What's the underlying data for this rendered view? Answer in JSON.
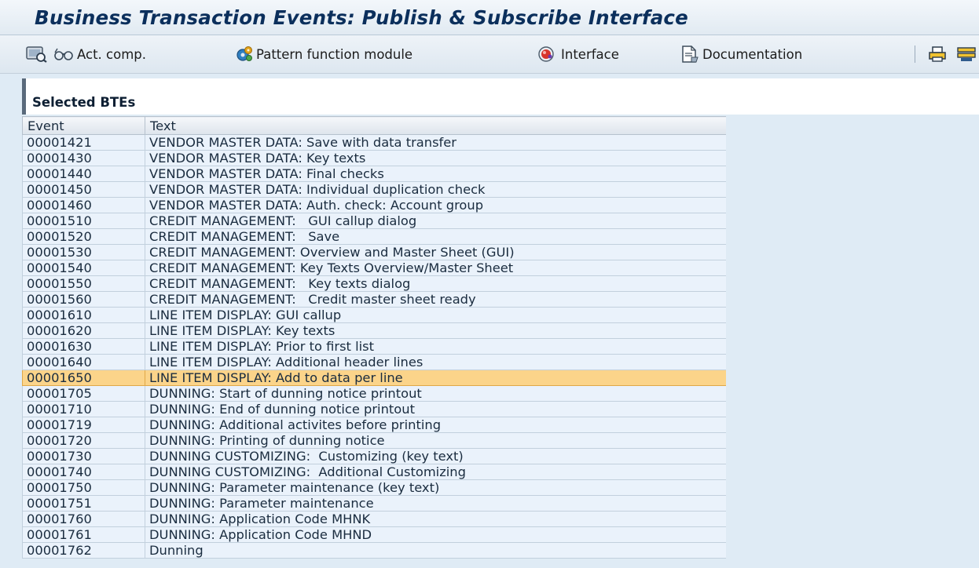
{
  "window": {
    "title": "Business Transaction Events: Publish & Subscribe Interface"
  },
  "toolbar": {
    "buttons": [
      {
        "id": "display",
        "label": "",
        "icon": "display-glasses-icon"
      },
      {
        "id": "act_comp",
        "label": "Act. comp.",
        "icon": "glasses-icon"
      },
      {
        "id": "pattern",
        "label": "Pattern function module",
        "icon": "gear-pattern-icon"
      },
      {
        "id": "interface",
        "label": "Interface",
        "icon": "interface-icon"
      },
      {
        "id": "documentation",
        "label": "Documentation",
        "icon": "document-icon"
      },
      {
        "id": "print",
        "label": "",
        "icon": "printer-icon"
      },
      {
        "id": "filter",
        "label": "",
        "icon": "filter-icon"
      }
    ]
  },
  "panel": {
    "title": "Selected BTEs"
  },
  "table": {
    "columns": [
      "Event",
      "Text"
    ],
    "selected_index": 15,
    "rows": [
      {
        "event": "00001421",
        "text": "VENDOR MASTER DATA: Save with data transfer"
      },
      {
        "event": "00001430",
        "text": "VENDOR MASTER DATA: Key texts"
      },
      {
        "event": "00001440",
        "text": "VENDOR MASTER DATA: Final checks"
      },
      {
        "event": "00001450",
        "text": "VENDOR MASTER DATA: Individual duplication check"
      },
      {
        "event": "00001460",
        "text": "VENDOR MASTER DATA: Auth. check: Account group"
      },
      {
        "event": "00001510",
        "text": "CREDIT MANAGEMENT:   GUI callup dialog"
      },
      {
        "event": "00001520",
        "text": "CREDIT MANAGEMENT:   Save"
      },
      {
        "event": "00001530",
        "text": "CREDIT MANAGEMENT: Overview and Master Sheet (GUI)"
      },
      {
        "event": "00001540",
        "text": "CREDIT MANAGEMENT: Key Texts Overview/Master Sheet"
      },
      {
        "event": "00001550",
        "text": "CREDIT MANAGEMENT:   Key texts dialog"
      },
      {
        "event": "00001560",
        "text": "CREDIT MANAGEMENT:   Credit master sheet ready"
      },
      {
        "event": "00001610",
        "text": "LINE ITEM DISPLAY: GUI callup"
      },
      {
        "event": "00001620",
        "text": "LINE ITEM DISPLAY: Key texts"
      },
      {
        "event": "00001630",
        "text": "LINE ITEM DISPLAY: Prior to first list"
      },
      {
        "event": "00001640",
        "text": "LINE ITEM DISPLAY: Additional header lines"
      },
      {
        "event": "00001650",
        "text": "LINE ITEM DISPLAY: Add to data per line"
      },
      {
        "event": "00001705",
        "text": "DUNNING: Start of dunning notice printout"
      },
      {
        "event": "00001710",
        "text": "DUNNING: End of dunning notice printout"
      },
      {
        "event": "00001719",
        "text": "DUNNING: Additional activites before printing"
      },
      {
        "event": "00001720",
        "text": "DUNNING: Printing of dunning notice"
      },
      {
        "event": "00001730",
        "text": "DUNNING CUSTOMIZING:  Customizing (key text)"
      },
      {
        "event": "00001740",
        "text": "DUNNING CUSTOMIZING:  Additional Customizing"
      },
      {
        "event": "00001750",
        "text": "DUNNING: Parameter maintenance (key text)"
      },
      {
        "event": "00001751",
        "text": "DUNNING: Parameter maintenance"
      },
      {
        "event": "00001760",
        "text": "DUNNING: Application Code MHNK"
      },
      {
        "event": "00001761",
        "text": "DUNNING: Application Code MHND"
      },
      {
        "event": "00001762",
        "text": "Dunning"
      }
    ]
  },
  "colors": {
    "selected_row": "#fbd48a",
    "row_bg": "#eaf2fb",
    "title_text": "#0b2f5c"
  }
}
